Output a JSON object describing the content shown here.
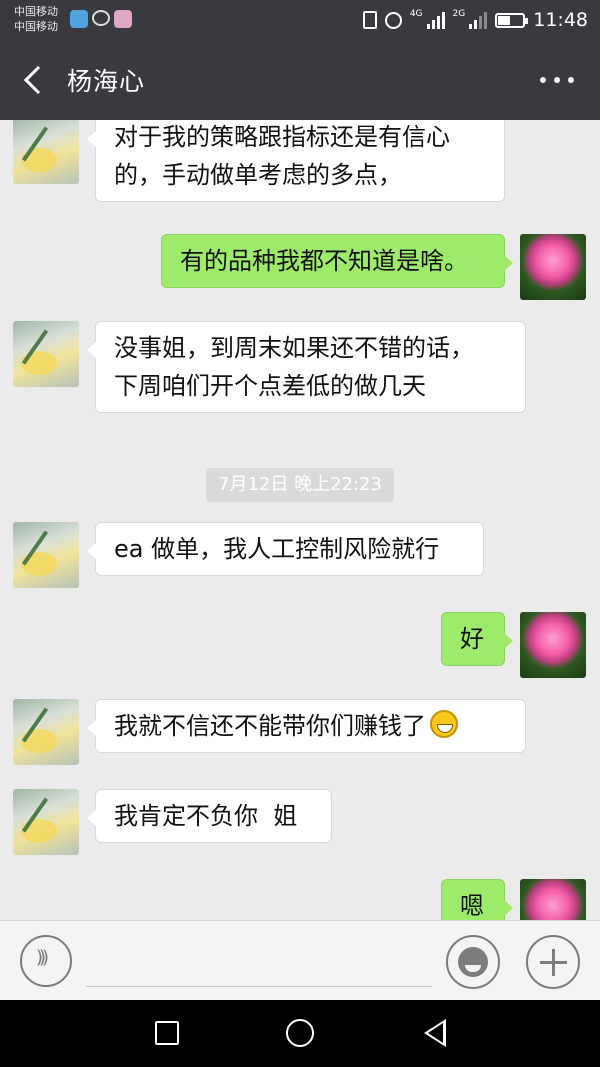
{
  "status_bar": {
    "carrier1": "中国移动",
    "carrier2": "中国移动",
    "net1": "4G",
    "net2": "2G",
    "time": "11:48"
  },
  "header": {
    "title": "杨海心",
    "back_icon": "chevron-left-icon",
    "more_icon": "more-dots-icon"
  },
  "messages": [
    {
      "side": "left",
      "lines": [
        "对于我的策略跟指标还是有信心",
        "的，手动做单考虑的多点，"
      ]
    },
    {
      "side": "right",
      "lines": [
        "有的品种我都不知道是啥。"
      ]
    },
    {
      "side": "left",
      "lines": [
        "没事姐，到周末如果还不错的话，",
        "下周咱们开个点差低的做几天"
      ]
    },
    {
      "side": "left",
      "lines": [
        "ea 做单，我人工控制风险就行"
      ]
    },
    {
      "side": "right",
      "lines": [
        "好"
      ]
    },
    {
      "side": "left",
      "lines": [
        "我就不信还不能带你们赚钱了"
      ],
      "emoji": "grinning-emoji"
    },
    {
      "side": "left",
      "lines": [
        "我肯定不负你  姐"
      ]
    },
    {
      "side": "right",
      "lines": [
        "嗯"
      ]
    }
  ],
  "timestamp": "7月12日 晚上22:23",
  "input_bar": {
    "voice_icon": "voice-icon",
    "emoji_icon": "emoji-icon",
    "plus_icon": "plus-icon"
  },
  "colors": {
    "header_bg": "#393a3f",
    "chat_bg": "#ebebeb",
    "sent_bubble": "#9eea6a",
    "received_bubble": "#ffffff"
  }
}
